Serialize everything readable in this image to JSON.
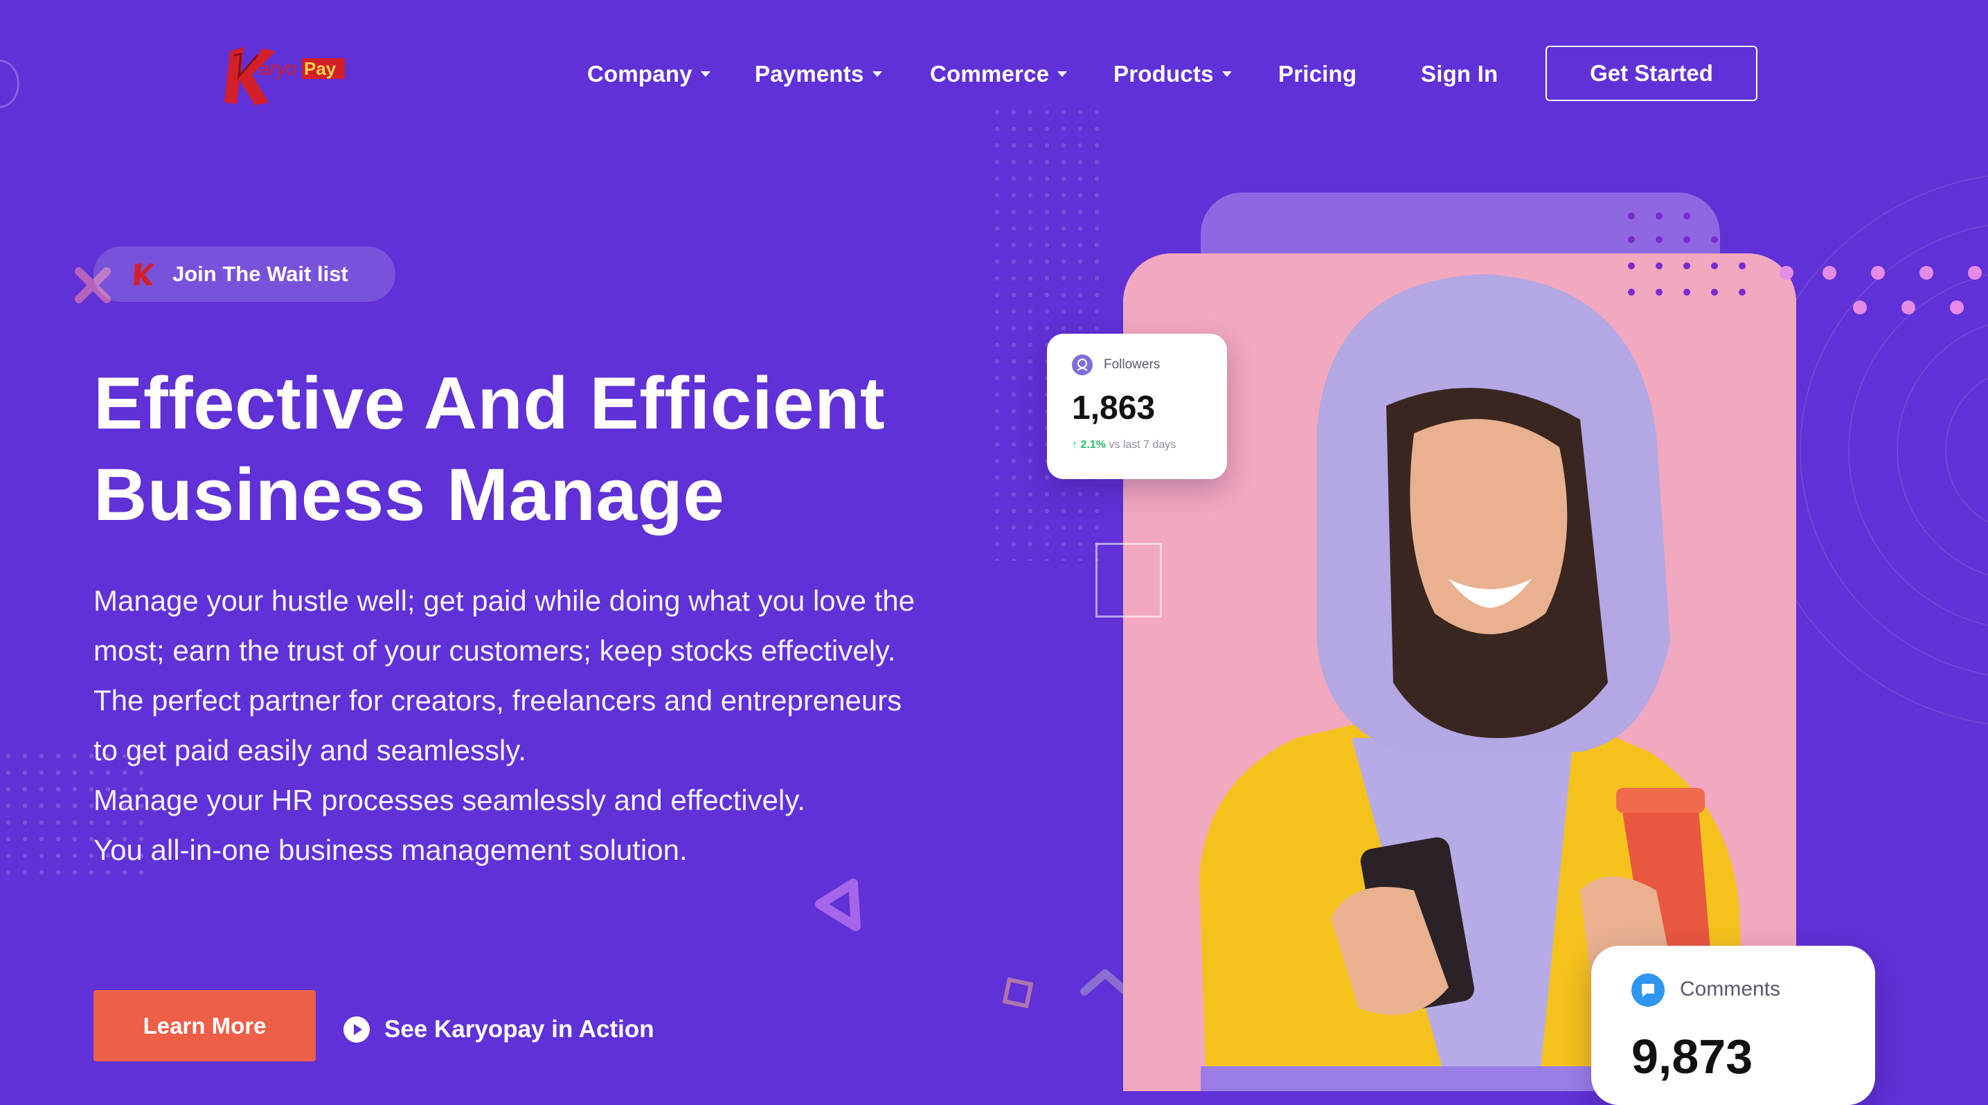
{
  "brand": {
    "logo_text_top": "KaryoPay",
    "logo_letter": "K"
  },
  "nav": {
    "items": [
      {
        "label": "Company",
        "has_dropdown": true
      },
      {
        "label": "Payments",
        "has_dropdown": true
      },
      {
        "label": "Commerce",
        "has_dropdown": true
      },
      {
        "label": "Products",
        "has_dropdown": true
      },
      {
        "label": "Pricing",
        "has_dropdown": false
      },
      {
        "label": "Sign In",
        "has_dropdown": false
      }
    ],
    "cta": "Get Started"
  },
  "hero": {
    "badge": "Join The Wait list",
    "title_line1": "Effective And Efficient",
    "title_line2": "Business Manage",
    "description": [
      "Manage your hustle well; get paid while doing what you love the most; earn the trust of your customers; keep stocks effectively.",
      "The perfect partner for creators, freelancers and entrepreneurs to get paid easily and seamlessly.",
      "Manage your HR processes seamlessly and effectively.",
      "You all-in-one business management solution."
    ],
    "primary_button": "Learn More",
    "secondary_link": "See Karyopay in Action"
  },
  "stats": {
    "followers": {
      "title": "Followers",
      "value": "1,863",
      "change": "2.1%",
      "change_suffix": "vs last 7 days"
    },
    "comments": {
      "title": "Comments",
      "value": "9,873"
    }
  },
  "colors": {
    "background": "#6031d6",
    "accent_button": "#ee5f48",
    "photo_backdrop": "#f2a8be",
    "positive": "#2bbf6a"
  },
  "icons": [
    "karyopay-logo",
    "chevron-down-icon",
    "k-logo-icon",
    "play-icon",
    "followers-icon",
    "comment-icon"
  ]
}
